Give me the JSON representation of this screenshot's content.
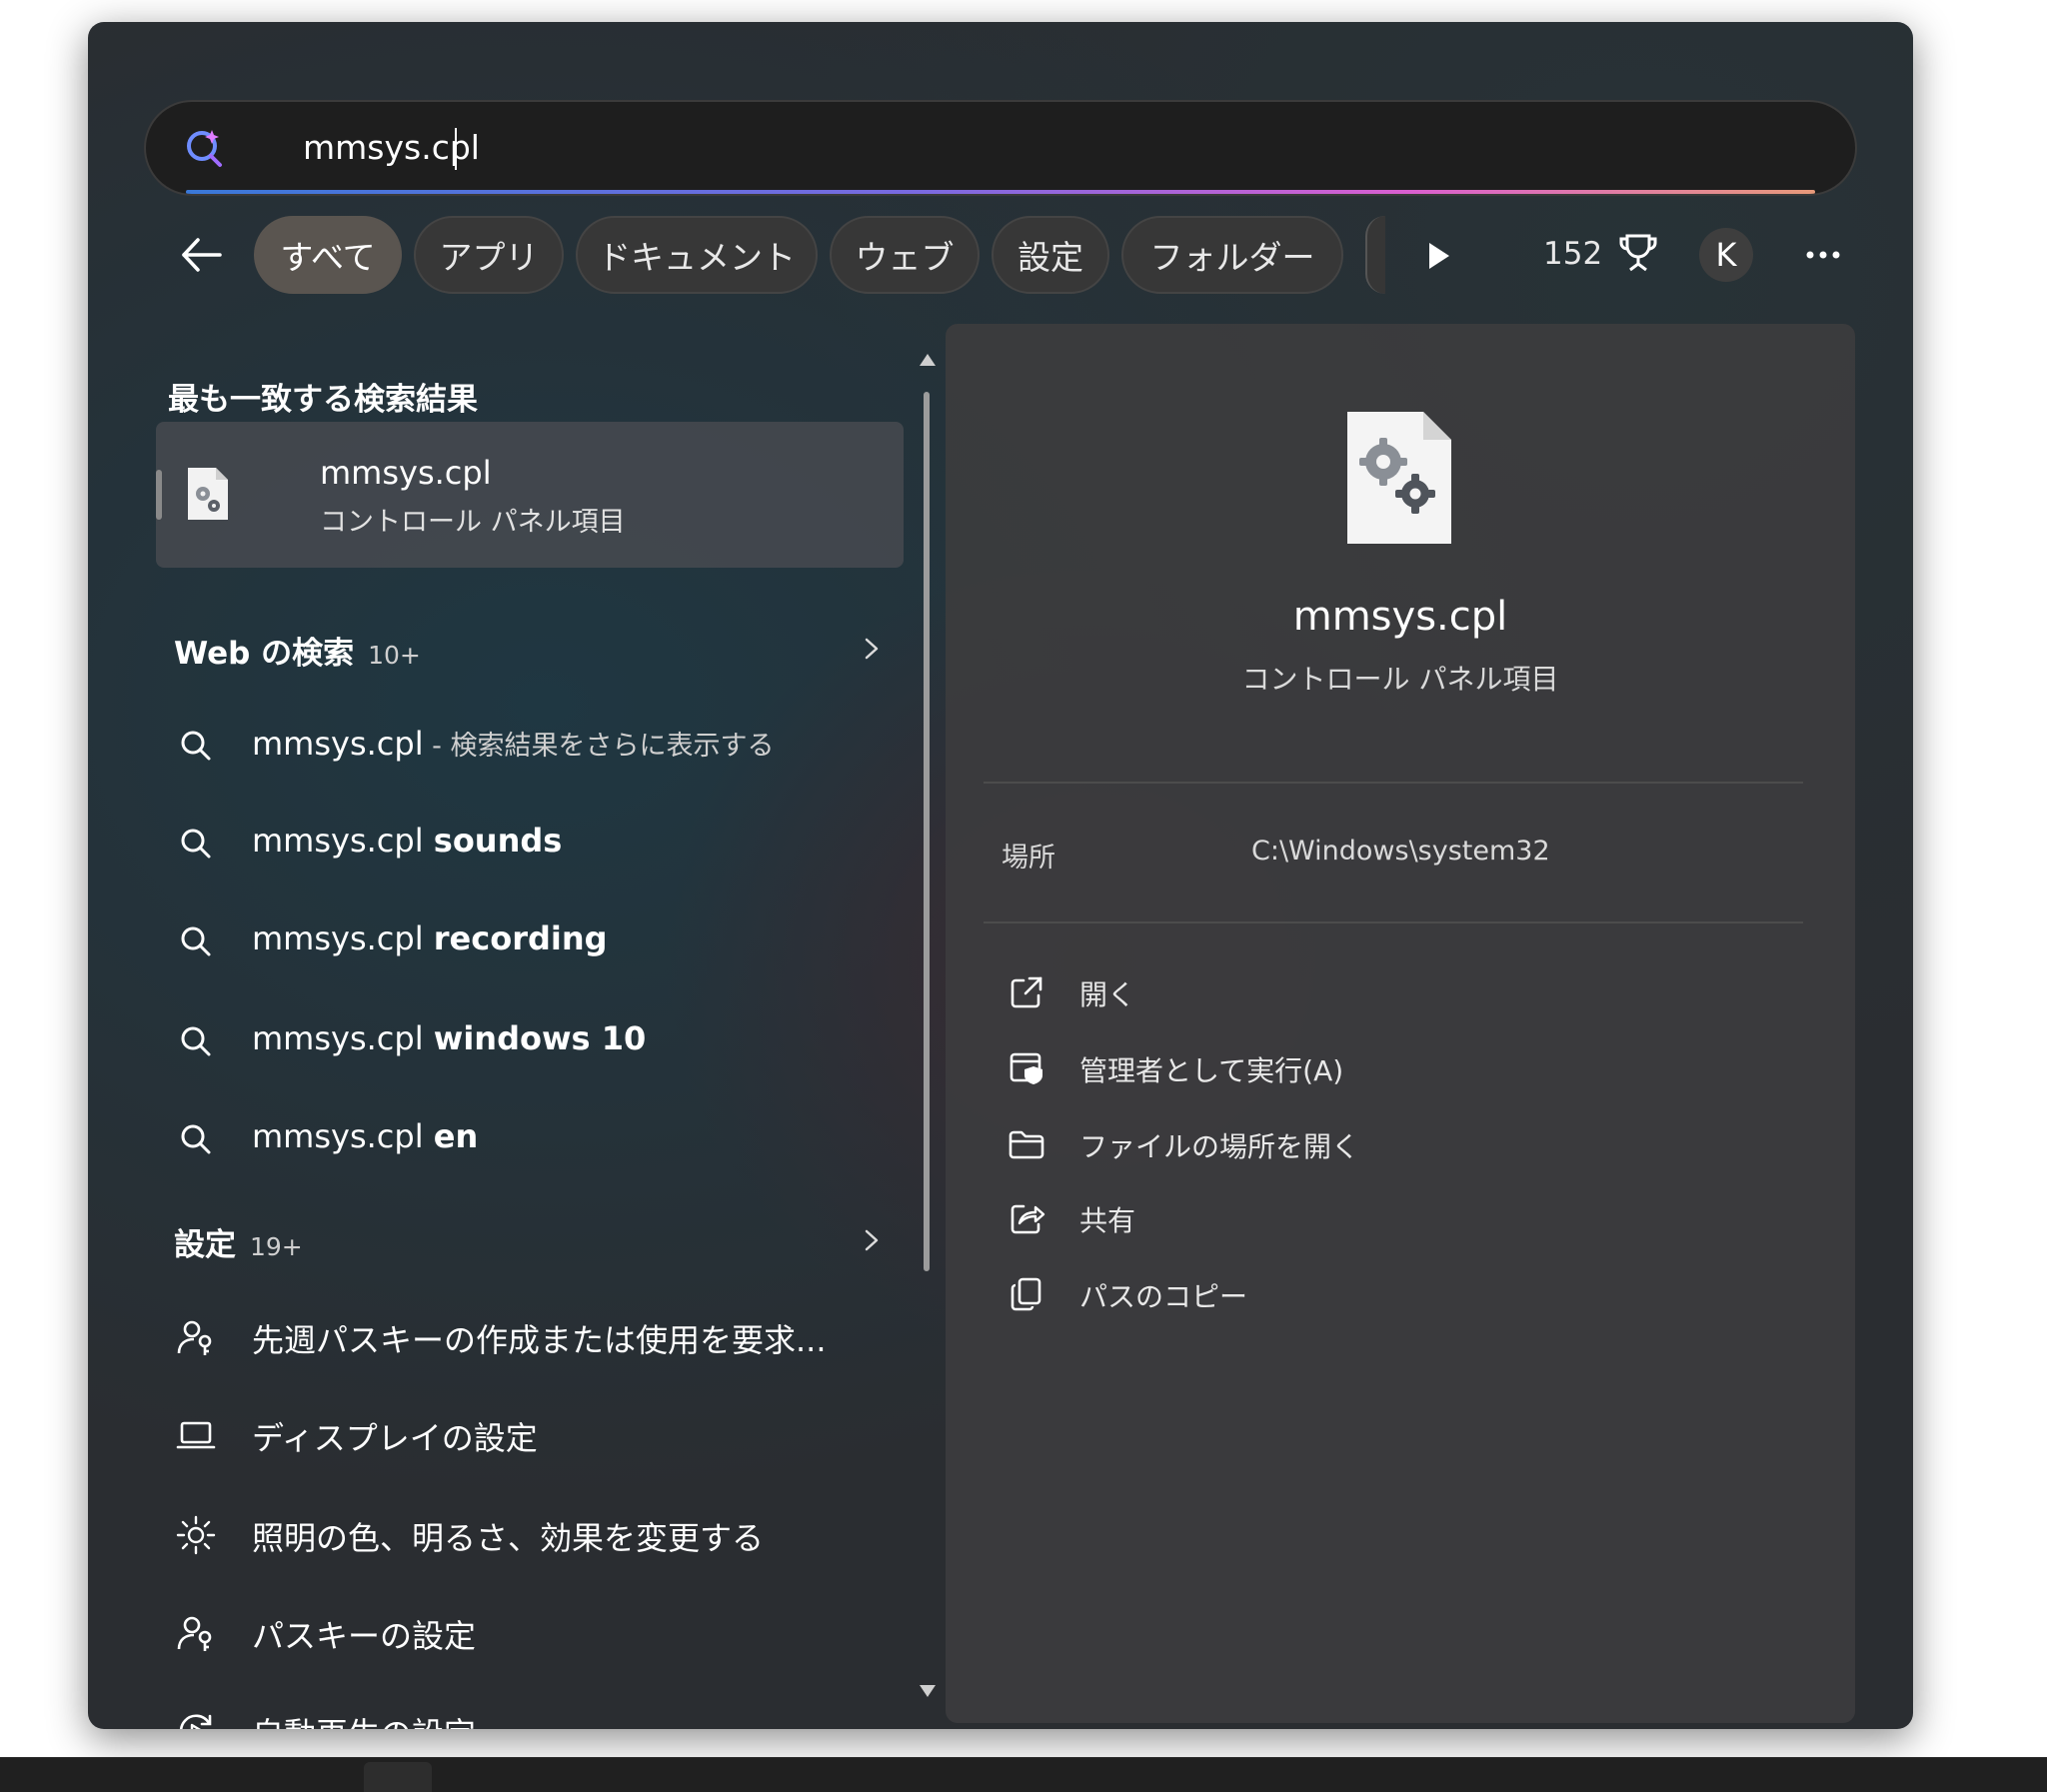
{
  "search": {
    "query": "mmsys.cpl",
    "placeholder": ""
  },
  "filters": {
    "items": [
      "すべて",
      "アプリ",
      "ドキュメント",
      "ウェブ",
      "設定",
      "フォルダー"
    ],
    "active": "すべて"
  },
  "toolbar": {
    "points": "152",
    "avatar_initial": "K"
  },
  "best_match": {
    "heading": "最も一致する検索結果",
    "title": "mmsys.cpl",
    "subtitle": "コントロール パネル項目"
  },
  "web_search": {
    "heading": "Web の検索",
    "count": "10+",
    "items": [
      {
        "base": "mmsys.cpl",
        "suffix": " - 検索結果をさらに表示する",
        "bold": ""
      },
      {
        "base": "mmsys.cpl ",
        "suffix": "",
        "bold": "sounds"
      },
      {
        "base": "mmsys.cpl ",
        "suffix": "",
        "bold": "recording"
      },
      {
        "base": "mmsys.cpl ",
        "suffix": "",
        "bold": "windows 10"
      },
      {
        "base": "mmsys.cpl ",
        "suffix": "",
        "bold": "en"
      }
    ]
  },
  "settings": {
    "heading": "設定",
    "count": "19+",
    "items": [
      {
        "label": "先週パスキーの作成または使用を要求...",
        "icon": "person-key-icon"
      },
      {
        "label": "ディスプレイの設定",
        "icon": "laptop-icon"
      },
      {
        "label": "照明の色、明るさ、効果を変更する",
        "icon": "sun-icon"
      },
      {
        "label": "パスキーの設定",
        "icon": "person-key-icon"
      },
      {
        "label": "自動再生の設定",
        "icon": "autoplay-icon"
      }
    ]
  },
  "detail": {
    "title": "mmsys.cpl",
    "subtitle": "コントロール パネル項目",
    "location_label": "場所",
    "location_value": "C:\\Windows\\system32",
    "actions": [
      {
        "label": "開く",
        "icon": "open-external-icon"
      },
      {
        "label": "管理者として実行(A)",
        "icon": "shield-window-icon"
      },
      {
        "label": "ファイルの場所を開く",
        "icon": "folder-icon"
      },
      {
        "label": "共有",
        "icon": "share-icon"
      },
      {
        "label": "パスのコピー",
        "icon": "copy-icon"
      }
    ]
  },
  "colors": {
    "accent_gradient_start": "#3a78d8",
    "accent_gradient_end": "#e89a7a",
    "active_chip": "#5a5550"
  }
}
